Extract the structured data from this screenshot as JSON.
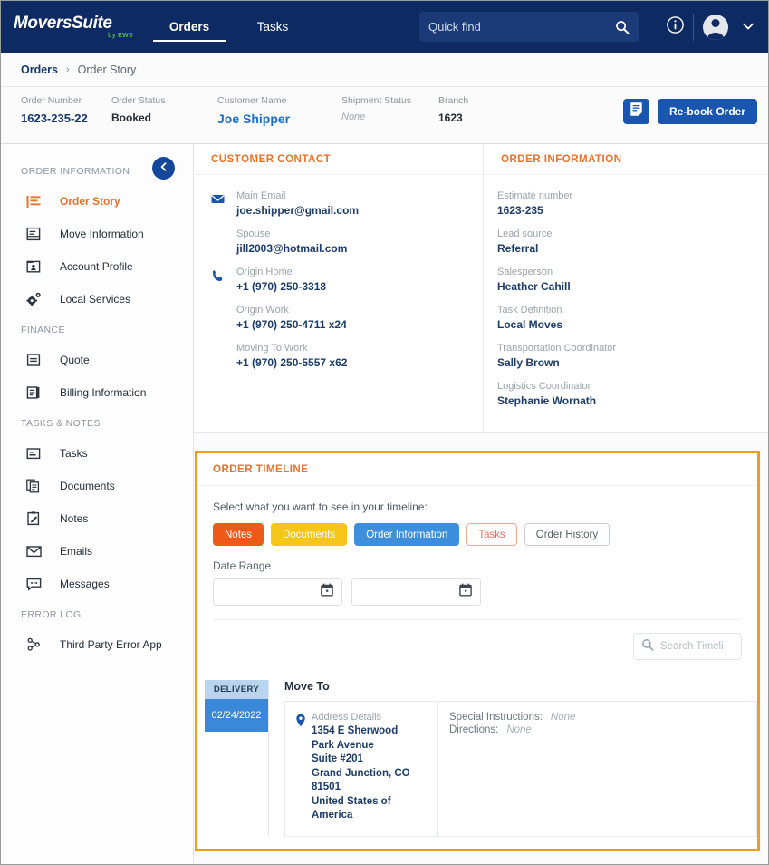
{
  "brand": {
    "name": "MoversSuite",
    "sub": "by EWS",
    "navy": "#0e2a63",
    "orange": "#e8732a",
    "blue": "#1a56b0"
  },
  "topnav": {
    "items": [
      {
        "label": "Orders",
        "active": true
      },
      {
        "label": "Tasks",
        "active": false
      }
    ],
    "quickfind_placeholder": "Quick find",
    "icons": {
      "search": "search-icon",
      "info": "info-circle-icon",
      "avatar": "user-avatar-icon",
      "chevron": "chevron-down-icon"
    }
  },
  "breadcrumb": {
    "root": "Orders",
    "separator": "›",
    "current": "Order Story"
  },
  "summary": {
    "fields": [
      {
        "label": "Order Number",
        "value": "1623-235-22",
        "style": "navy"
      },
      {
        "label": "Order Status",
        "value": "Booked",
        "style": "dark"
      },
      {
        "label": "Customer Name",
        "value": "Joe Shipper",
        "style": "link"
      },
      {
        "label": "Shipment Status",
        "value": "None",
        "style": "none"
      },
      {
        "label": "Branch",
        "value": "1623",
        "style": "dark"
      }
    ],
    "note_icon": "note-document-icon",
    "rebook_label": "Re-book Order"
  },
  "sidebar": {
    "collapse_icon": "chevron-left-icon",
    "groups": [
      {
        "title": "ORDER INFORMATION",
        "items": [
          {
            "label": "Order Story",
            "icon": "order-story-icon",
            "active": true
          },
          {
            "label": "Move Information",
            "icon": "move-information-icon",
            "active": false
          },
          {
            "label": "Account Profile",
            "icon": "account-profile-icon",
            "active": false
          },
          {
            "label": "Local Services",
            "icon": "local-services-gear-icon",
            "active": false
          }
        ]
      },
      {
        "title": "FINANCE",
        "items": [
          {
            "label": "Quote",
            "icon": "quote-icon",
            "active": false
          },
          {
            "label": "Billing Information",
            "icon": "billing-information-icon",
            "active": false
          }
        ]
      },
      {
        "title": "TASKS & NOTES",
        "items": [
          {
            "label": "Tasks",
            "icon": "tasks-icon",
            "active": false
          },
          {
            "label": "Documents",
            "icon": "documents-icon",
            "active": false
          },
          {
            "label": "Notes",
            "icon": "notes-icon",
            "active": false
          },
          {
            "label": "Emails",
            "icon": "email-envelope-icon",
            "active": false
          },
          {
            "label": "Messages",
            "icon": "messages-bubble-icon",
            "active": false
          }
        ]
      },
      {
        "title": "ERROR LOG",
        "items": [
          {
            "label": "Third Party Error App",
            "icon": "third-party-error-icon",
            "active": false
          }
        ]
      }
    ]
  },
  "customer_contact": {
    "title": "CUSTOMER CONTACT",
    "rows": [
      {
        "icon": "email-envelope-icon",
        "label": "Main Email",
        "value": "joe.shipper@gmail.com"
      },
      {
        "icon": "",
        "label": "Spouse",
        "value": "jill2003@hotmail.com"
      },
      {
        "icon": "phone-icon",
        "label": "Origin Home",
        "value": "+1 (970) 250-3318"
      },
      {
        "icon": "",
        "label": "Origin Work",
        "value": "+1 (970) 250-4711 x24"
      },
      {
        "icon": "",
        "label": "Moving To Work",
        "value": "+1 (970) 250-5557 x62"
      }
    ]
  },
  "order_information": {
    "title": "ORDER INFORMATION",
    "fields": [
      {
        "label": "Estimate number",
        "value": "1623-235"
      },
      {
        "label": "Lead source",
        "value": "Referral"
      },
      {
        "label": "Salesperson",
        "value": "Heather Cahill"
      },
      {
        "label": "Task Definition",
        "value": "Local Moves"
      },
      {
        "label": "Transportation Coordinator",
        "value": "Sally Brown"
      },
      {
        "label": "Logistics Coordinator",
        "value": "Stephanie Wornath"
      }
    ]
  },
  "order_timeline": {
    "title": "ORDER TIMELINE",
    "prompt": "Select what you want to see in your timeline:",
    "chips": [
      {
        "label": "Notes",
        "bg": "#ef5a18",
        "fg": "#ffffff",
        "border": "#ef5a18"
      },
      {
        "label": "Documents",
        "bg": "#f5c518",
        "fg": "#ffffff",
        "border": "#f5c518"
      },
      {
        "label": "Order Information",
        "bg": "#3d8fdd",
        "fg": "#ffffff",
        "border": "#3d8fdd"
      },
      {
        "label": "Tasks",
        "bg": "#ffffff",
        "fg": "#e8705f",
        "border": "#eda79c"
      },
      {
        "label": "Order History",
        "bg": "#ffffff",
        "fg": "#55606d",
        "border": "#c9ced5"
      }
    ],
    "date_range_label": "Date Range",
    "date_from": "",
    "date_to": "",
    "calendar_icon": "calendar-icon",
    "search_placeholder": "Search Timeli",
    "search_icon": "search-icon",
    "entries": [
      {
        "type": "DELIVERY",
        "date": "02/24/2022",
        "title": "Move To",
        "address_label": "Address Details",
        "address_lines": [
          "1354 E Sherwood",
          "Park Avenue",
          "Suite #201",
          "Grand Junction, CO",
          "81501",
          "United States of",
          "America"
        ],
        "pin_icon": "map-pin-icon",
        "details": [
          {
            "key": "Special Instructions:",
            "value": "None"
          },
          {
            "key": "Directions:",
            "value": "None"
          }
        ]
      }
    ]
  }
}
